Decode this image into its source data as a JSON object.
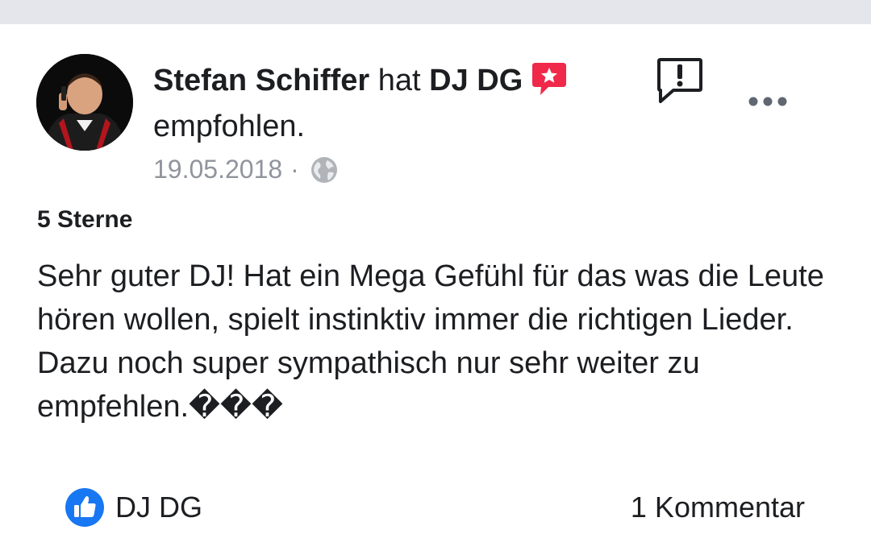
{
  "post": {
    "author": "Stefan Schiffer",
    "verb": "hat",
    "page": "DJ DG",
    "action": "empfohlen.",
    "date": "19.05.2018",
    "separator": "·",
    "rating": "5 Sterne",
    "text": "Sehr guter DJ! Hat ein Mega Gefühl für das was die Leute hören wollen, spielt instinktiv immer die richtigen Lieder. Dazu noch super sympathisch nur sehr weiter zu empfehlen.���"
  },
  "footer": {
    "like_name": "DJ DG",
    "comments": "1 Kommentar"
  },
  "icons": {
    "recommendation": "recommendation-star-bubble-icon",
    "report": "report-exclamation-bubble-icon",
    "more": "more-options-dots-icon",
    "privacy": "public-globe-icon",
    "like": "like-thumb-icon"
  },
  "colors": {
    "accent_blue": "#1877f2",
    "recommend_red": "#f02849",
    "meta_gray": "#90949c",
    "text": "#1c1e21"
  }
}
